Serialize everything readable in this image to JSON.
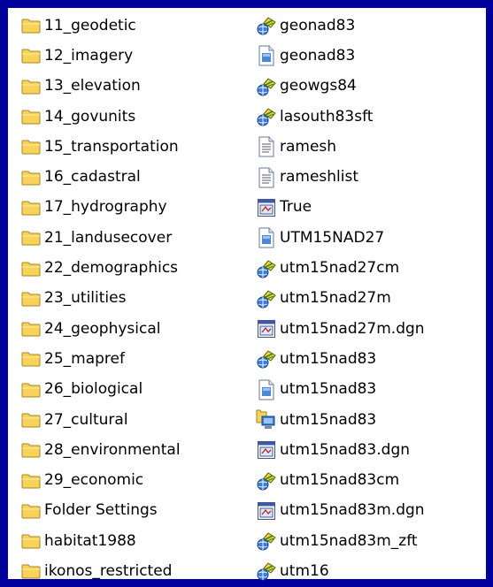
{
  "colors": {
    "background": "#00009c",
    "panel": "#ffffff",
    "folder": "#f7d35a"
  },
  "left": [
    {
      "label": "11_geodetic",
      "icon": "folder-icon"
    },
    {
      "label": "12_imagery",
      "icon": "folder-icon"
    },
    {
      "label": "13_elevation",
      "icon": "folder-icon"
    },
    {
      "label": "14_govunits",
      "icon": "folder-icon"
    },
    {
      "label": "15_transportation",
      "icon": "folder-icon"
    },
    {
      "label": "16_cadastral",
      "icon": "folder-icon"
    },
    {
      "label": "17_hydrography",
      "icon": "folder-icon"
    },
    {
      "label": "21_landusecover",
      "icon": "folder-icon"
    },
    {
      "label": "22_demographics",
      "icon": "folder-icon"
    },
    {
      "label": "23_utilities",
      "icon": "folder-icon"
    },
    {
      "label": "24_geophysical",
      "icon": "folder-icon"
    },
    {
      "label": "25_mapref",
      "icon": "folder-icon"
    },
    {
      "label": "26_biological",
      "icon": "folder-icon"
    },
    {
      "label": "27_cultural",
      "icon": "folder-icon"
    },
    {
      "label": "28_environmental",
      "icon": "folder-icon"
    },
    {
      "label": "29_economic",
      "icon": "folder-icon"
    },
    {
      "label": "Folder Settings",
      "icon": "folder-icon"
    },
    {
      "label": "habitat1988",
      "icon": "folder-icon"
    },
    {
      "label": "ikonos_restricted",
      "icon": "folder-icon"
    }
  ],
  "right": [
    {
      "label": "geonad83",
      "icon": "projection-file-icon"
    },
    {
      "label": "geonad83",
      "icon": "document-file-icon"
    },
    {
      "label": "geowgs84",
      "icon": "projection-file-icon"
    },
    {
      "label": "lasouth83sft",
      "icon": "projection-file-icon"
    },
    {
      "label": "ramesh",
      "icon": "text-file-icon"
    },
    {
      "label": "rameshlist",
      "icon": "text-file-icon"
    },
    {
      "label": "True",
      "icon": "dgn-file-icon"
    },
    {
      "label": "UTM15NAD27",
      "icon": "document-file-icon"
    },
    {
      "label": "utm15nad27cm",
      "icon": "projection-file-icon"
    },
    {
      "label": "utm15nad27m",
      "icon": "projection-file-icon"
    },
    {
      "label": "utm15nad27m.dgn",
      "icon": "dgn-file-icon"
    },
    {
      "label": "utm15nad83",
      "icon": "projection-file-icon"
    },
    {
      "label": "utm15nad83",
      "icon": "document-file-icon"
    },
    {
      "label": "utm15nad83",
      "icon": "shortcut-monitor-icon"
    },
    {
      "label": "utm15nad83.dgn",
      "icon": "dgn-file-icon"
    },
    {
      "label": "utm15nad83cm",
      "icon": "projection-file-icon"
    },
    {
      "label": "utm15nad83m.dgn",
      "icon": "dgn-file-icon"
    },
    {
      "label": "utm15nad83m_zft",
      "icon": "projection-file-icon"
    },
    {
      "label": "utm16",
      "icon": "projection-file-icon"
    }
  ]
}
